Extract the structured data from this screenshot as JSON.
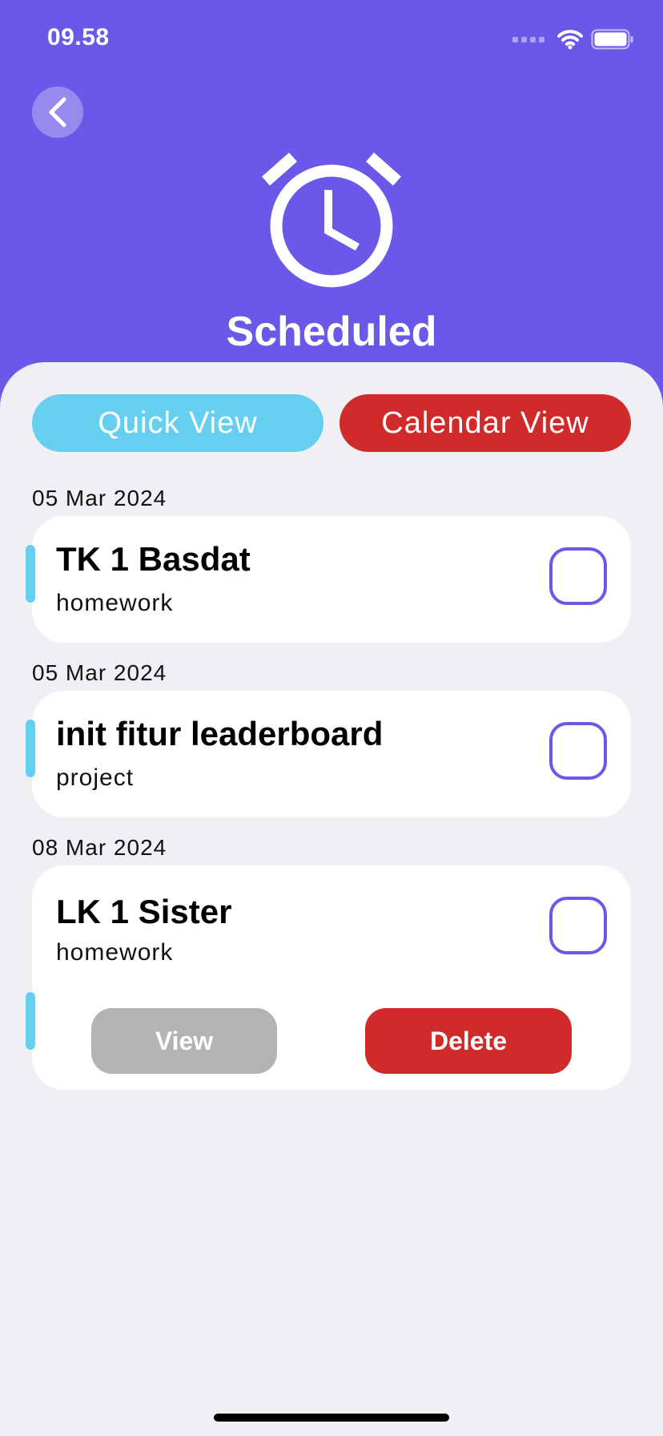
{
  "status_bar": {
    "time": "09.58"
  },
  "header": {
    "title": "Scheduled",
    "icon": "alarm-clock-icon",
    "background": "#6a58e9"
  },
  "view_toggle": {
    "quick_view": "Quick View",
    "calendar_view": "Calendar View",
    "quick_color": "#66cff0",
    "calendar_color": "#d12a2a"
  },
  "tasks": [
    {
      "date": "05 Mar 2024",
      "title": "TK 1 Basdat",
      "category": "homework",
      "completed": false
    },
    {
      "date": "05 Mar 2024",
      "title": "init fitur leaderboard",
      "category": "project",
      "completed": false
    },
    {
      "date": "08 Mar 2024",
      "title": "LK 1 Sister",
      "category": "homework",
      "completed": false,
      "expanded": true
    }
  ],
  "actions": {
    "view_label": "View",
    "delete_label": "Delete"
  }
}
